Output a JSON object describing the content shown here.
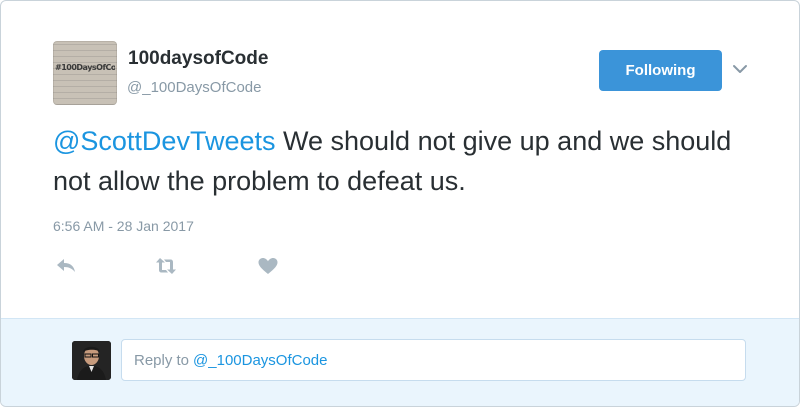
{
  "profile": {
    "display_name": "100daysofCode",
    "handle": "@_100DaysOfCode",
    "avatar_text": "#100DaysOfCode"
  },
  "follow_button": {
    "label": "Following"
  },
  "tweet": {
    "mention": "@ScottDevTweets",
    "text": " We should not give up and we should not allow the problem to defeat us.",
    "timestamp": "6:56 AM - 28 Jan 2017"
  },
  "actions": {
    "reply_icon": "reply-icon",
    "retweet_icon": "retweet-icon",
    "like_icon": "heart-icon"
  },
  "reply": {
    "prefix": "Reply to",
    "handle": "@_100DaysOfCode"
  },
  "colors": {
    "accent": "#3b94d9",
    "link": "#1b95e0",
    "muted": "#8899a6",
    "reply_bg": "#eaf5fd"
  }
}
